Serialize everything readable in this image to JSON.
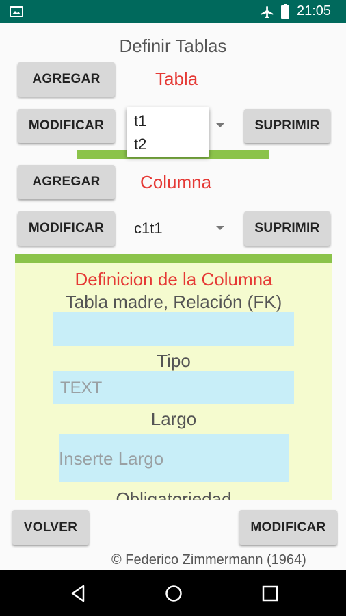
{
  "status_bar": {
    "time": "21:05",
    "icons": [
      "image-icon",
      "airplane-icon",
      "battery-icon"
    ]
  },
  "page": {
    "title": "Definir Tablas",
    "footer": "© Federico Zimmermann (1964)"
  },
  "tabla_section": {
    "label": "Tabla",
    "add_button": "AGREGAR",
    "modify_button": "MODIFICAR",
    "delete_button": "SUPRIMIR",
    "dropdown_options": [
      "t1",
      "t2"
    ]
  },
  "columna_section": {
    "label": "Columna",
    "add_button": "AGREGAR",
    "modify_button": "MODIFICAR",
    "delete_button": "SUPRIMIR",
    "selected_value": "c1t1"
  },
  "column_definition": {
    "heading": "Definicion de la Columna",
    "fk_label": "Tabla madre, Relación (FK)",
    "fk_value": "",
    "tipo_label": "Tipo",
    "tipo_placeholder": "TEXT",
    "largo_label": "Largo",
    "largo_placeholder": "Inserte Largo",
    "obligatoriedad_label": "Obligatoriedad"
  },
  "bottom_bar": {
    "back_button": "VOLVER",
    "modify_button": "MODIFICAR"
  },
  "nav_bar": {
    "icons": [
      "back-icon",
      "home-icon",
      "recents-icon"
    ]
  },
  "colors": {
    "status_bar": "#00695c",
    "accent_red": "#e53935",
    "green_bar": "#8bc34a",
    "panel_bg": "#f5fbcf",
    "field_bg": "#c8eef8"
  }
}
